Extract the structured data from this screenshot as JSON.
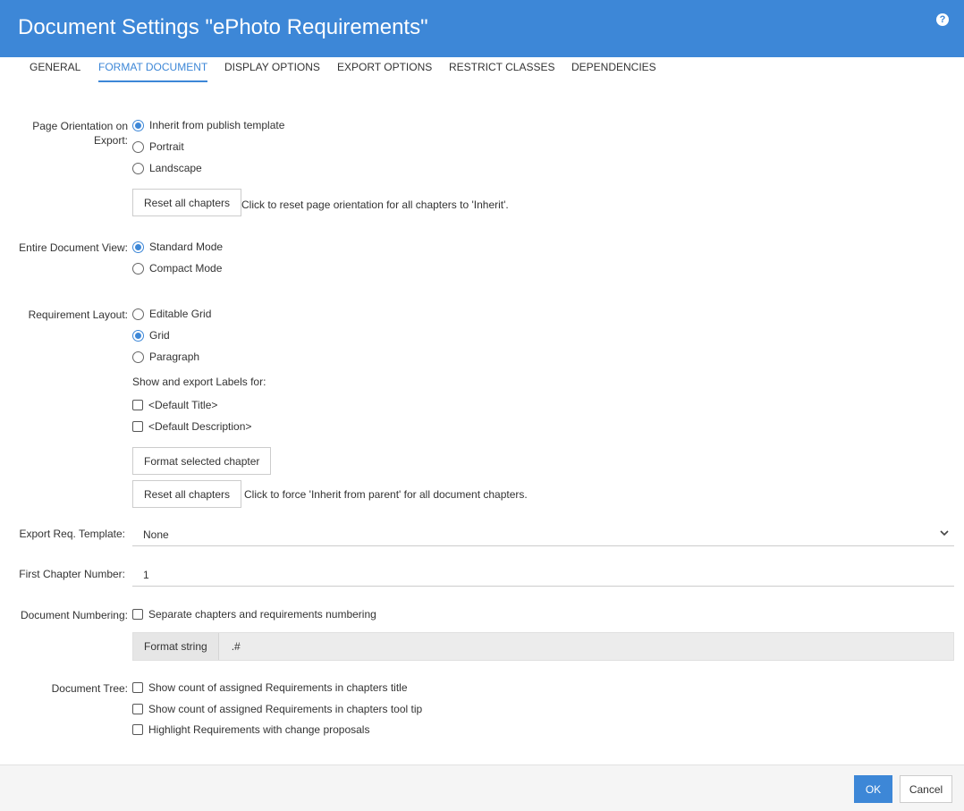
{
  "header": {
    "title": "Document Settings \"ePhoto Requirements\"",
    "help_icon": "?"
  },
  "tabs": [
    {
      "label": "GENERAL"
    },
    {
      "label": "FORMAT DOCUMENT"
    },
    {
      "label": "DISPLAY OPTIONS"
    },
    {
      "label": "EXPORT OPTIONS"
    },
    {
      "label": "RESTRICT CLASSES"
    },
    {
      "label": "DEPENDENCIES"
    }
  ],
  "page_orientation": {
    "label_line1": "Page Orientation on",
    "label_line2": "Export:",
    "options": [
      "Inherit from publish template",
      "Portrait",
      "Landscape"
    ],
    "selected": "Inherit from publish template",
    "reset_button": "Reset all chapters",
    "reset_hint": "Click to reset page orientation for all chapters to 'Inherit'."
  },
  "document_view": {
    "label": "Entire Document View:",
    "options": [
      "Standard Mode",
      "Compact Mode"
    ],
    "selected": "Standard Mode"
  },
  "requirement_layout": {
    "label": "Requirement Layout:",
    "options": [
      "Editable Grid",
      "Grid",
      "Paragraph"
    ],
    "selected": "Grid",
    "labels_heading": "Show and export Labels for:",
    "label_options": [
      "<Default Title>",
      "<Default Description>"
    ],
    "format_button": "Format selected chapter",
    "reset_button": "Reset all chapters",
    "reset_hint": "Click to force 'Inherit from parent' for all document chapters."
  },
  "export_template": {
    "label": "Export Req. Template:",
    "value": "None"
  },
  "first_chapter": {
    "label": "First Chapter Number:",
    "value": "1"
  },
  "document_numbering": {
    "label": "Document Numbering:",
    "option": "Separate chapters and requirements numbering",
    "format_label": "Format string",
    "format_value": ".#"
  },
  "document_tree": {
    "label": "Document Tree:",
    "options": [
      "Show count of assigned Requirements in chapters title",
      "Show count of assigned Requirements in chapters tool tip",
      "Highlight Requirements with change proposals"
    ]
  },
  "footer": {
    "ok": "OK",
    "cancel": "Cancel"
  },
  "colors": {
    "accent": "#3d87d7"
  }
}
